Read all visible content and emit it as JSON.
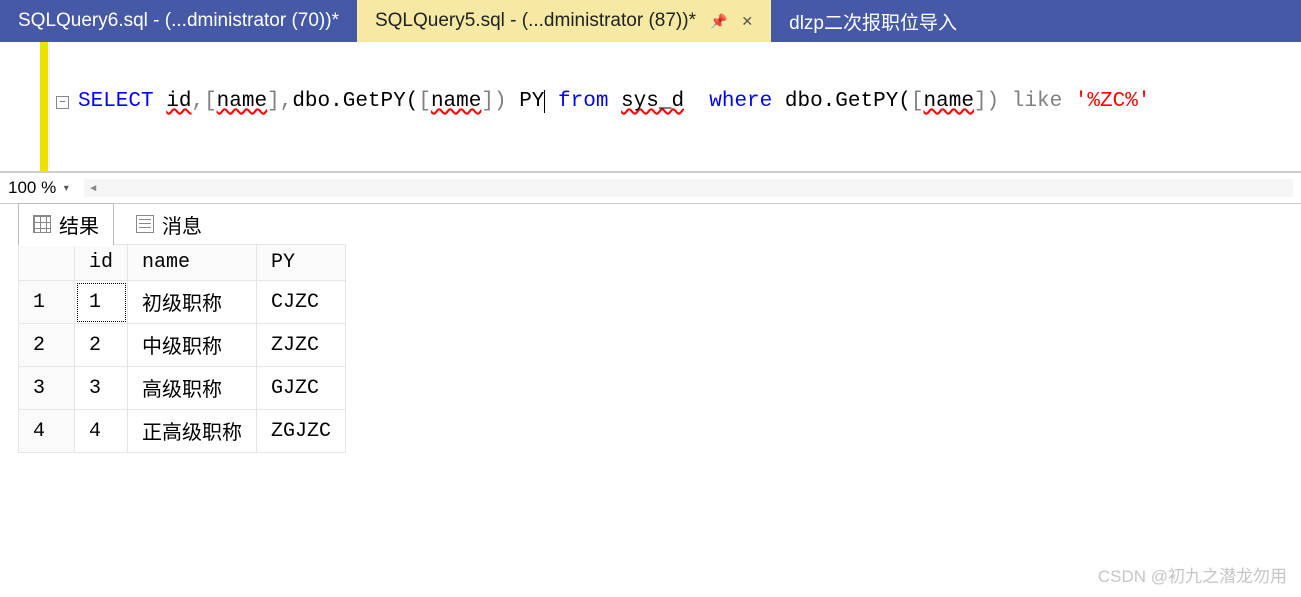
{
  "tabs": [
    {
      "label": "SQLQuery6.sql - (...dministrator (70))*"
    },
    {
      "label": "SQLQuery5.sql - (...dministrator (87))*"
    },
    {
      "label": "dlzp二次报职位导入"
    }
  ],
  "sql": {
    "select": "SELECT",
    "id": "id",
    "comma1": ",",
    "lbr1": "[",
    "name1": "name",
    "rbr1": "]",
    "comma2": ",",
    "dbo1": "dbo.GetPY(",
    "lbr2": "[",
    "name2": "name",
    "rbr2": "]",
    "rpar1": ")",
    "py": " PY",
    "from": " from ",
    "sysd": "sys_d",
    "where": "  where ",
    "dbo2": "dbo.GetPY(",
    "lbr3": "[",
    "name3": "name",
    "rbr3": "]",
    "rpar2": ")",
    "like": " like ",
    "str": "'%ZC%'"
  },
  "zoom": {
    "label": "100 %"
  },
  "resultsTabs": {
    "results": "结果",
    "messages": "消息"
  },
  "grid": {
    "headers": {
      "row": "",
      "id": "id",
      "name": "name",
      "py": "PY"
    },
    "rows": [
      {
        "n": "1",
        "id": "1",
        "name": "初级职称",
        "py": "CJZC"
      },
      {
        "n": "2",
        "id": "2",
        "name": "中级职称",
        "py": "ZJZC"
      },
      {
        "n": "3",
        "id": "3",
        "name": "高级职称",
        "py": "GJZC"
      },
      {
        "n": "4",
        "id": "4",
        "name": "正高级职称",
        "py": "ZGJZC"
      }
    ]
  },
  "watermark": "CSDN @初九之潜龙勿用",
  "icons": {
    "fold": "−",
    "dropdown": "▾",
    "scrollLeft": "◄",
    "pin": "📌",
    "close": "✕"
  }
}
